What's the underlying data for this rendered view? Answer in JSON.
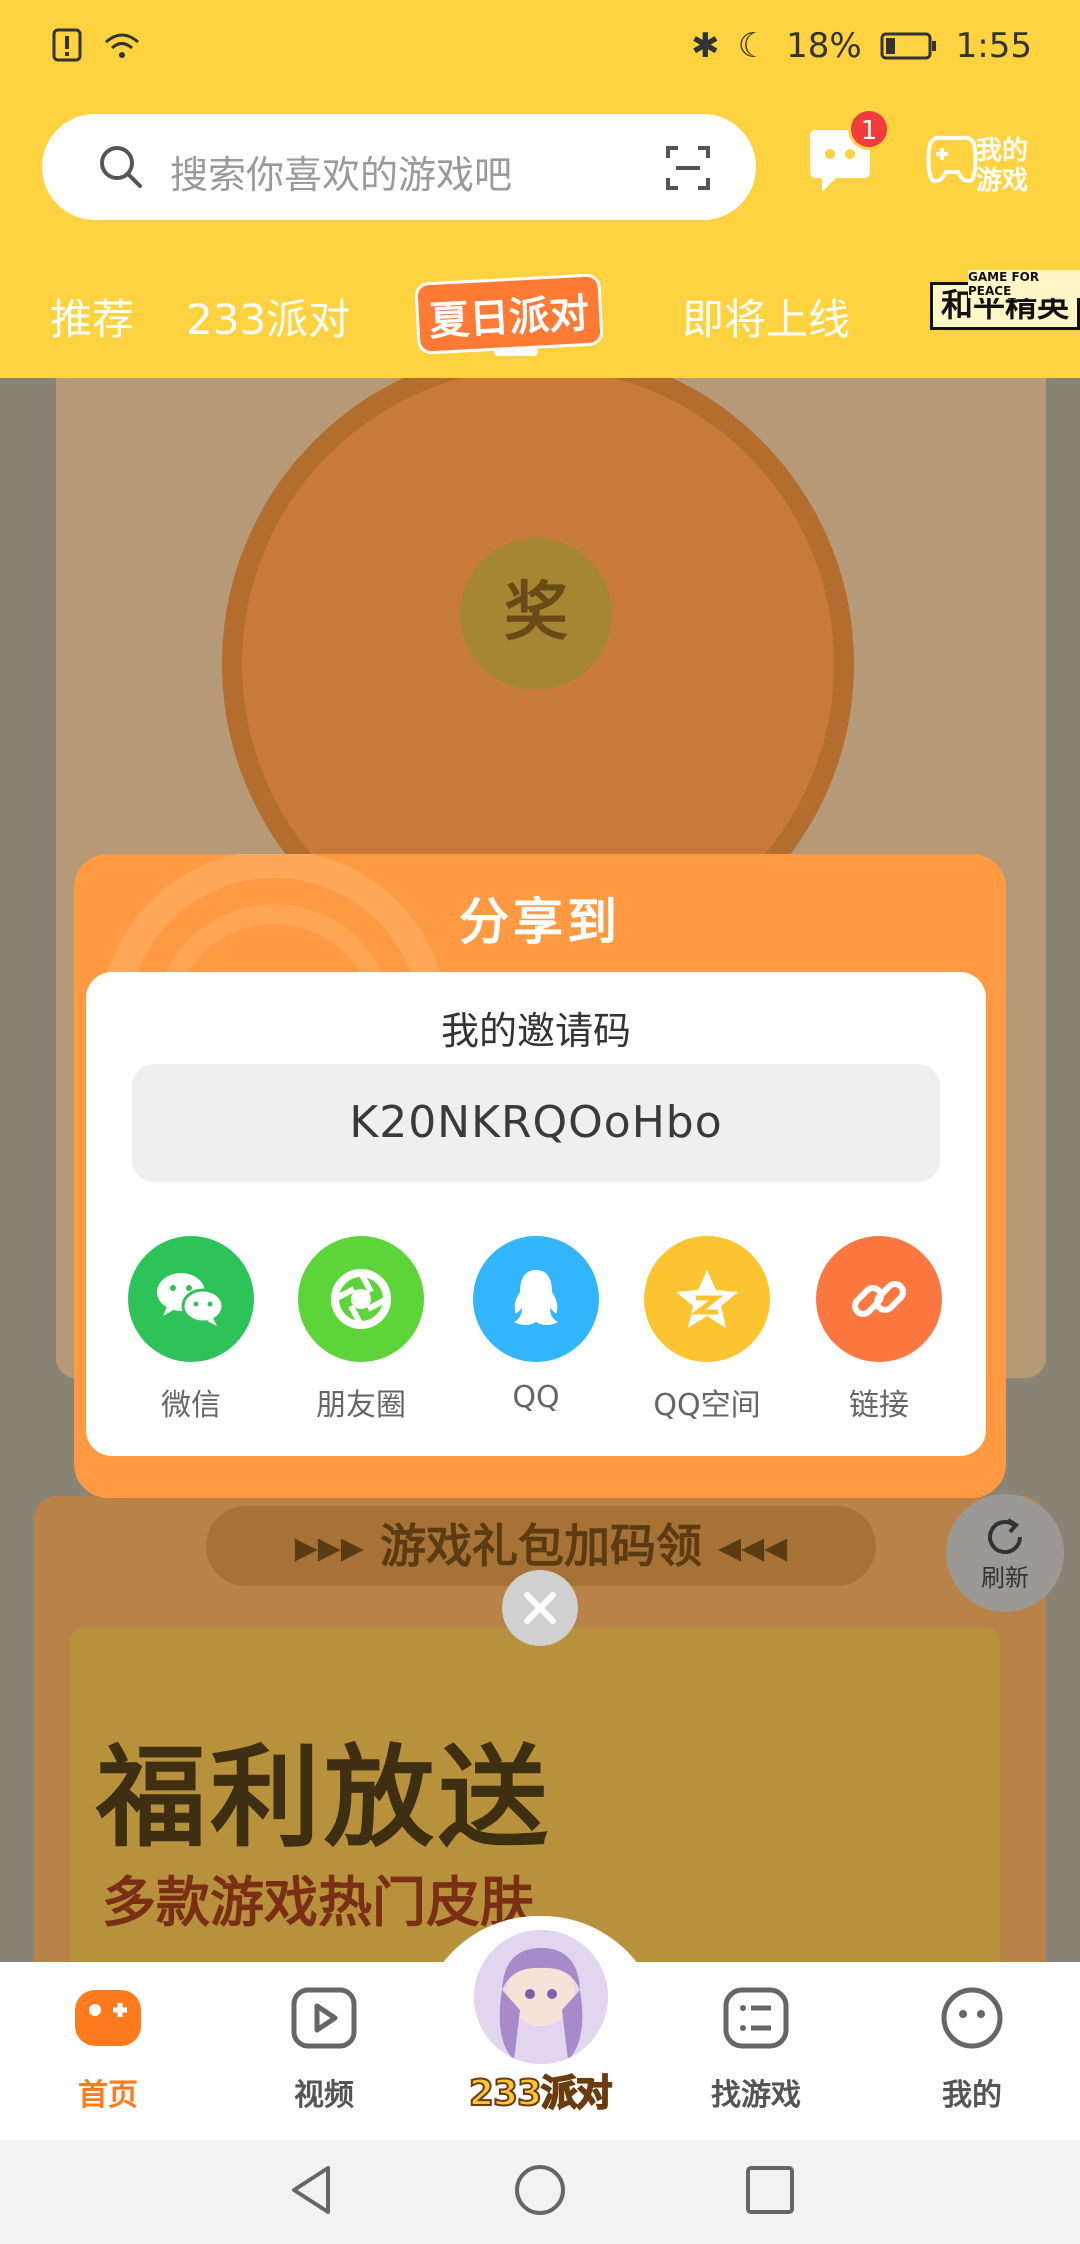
{
  "status_bar": {
    "battery": "18%",
    "time": "1:55"
  },
  "search": {
    "placeholder": "搜索你喜欢的游戏吧"
  },
  "messages": {
    "badge": "1"
  },
  "my_games": {
    "label_line1": "我的",
    "label_line2": "游戏"
  },
  "tabs": [
    {
      "label": "推荐"
    },
    {
      "label": "233派对"
    },
    {
      "label": "夏日派对"
    },
    {
      "label": "即将上线"
    },
    {
      "label": "和平精英",
      "small": "GAME FOR PEACE"
    }
  ],
  "background": {
    "wheel_center": "奖",
    "gift_title": "▸▸▸ 游戏礼包加码领 ◂◂◂",
    "banner_title": "福利放送",
    "banner_sub": "多款游戏热门皮肤",
    "refresh": "刷新"
  },
  "dialog": {
    "title": "分享到",
    "invite_label": "我的邀请码",
    "invite_code": "K20NKRQOoHbo",
    "share_options": [
      {
        "label": "微信",
        "color": "#2ec358",
        "icon": "wechat-icon"
      },
      {
        "label": "朋友圈",
        "color": "#5dd438",
        "icon": "moments-icon"
      },
      {
        "label": "QQ",
        "color": "#33b5fb",
        "icon": "qq-icon"
      },
      {
        "label": "QQ空间",
        "color": "#fbc430",
        "icon": "qzone-icon"
      },
      {
        "label": "链接",
        "color": "#fd7840",
        "icon": "link-icon"
      }
    ]
  },
  "bottom_nav": [
    {
      "label": "首页",
      "active": true
    },
    {
      "label": "视频"
    },
    {
      "label": "233派对"
    },
    {
      "label": "找游戏"
    },
    {
      "label": "我的"
    }
  ],
  "colors": {
    "header": "#fed33f",
    "accent": "#ff7b1e",
    "dialog": "#ff9a43"
  }
}
